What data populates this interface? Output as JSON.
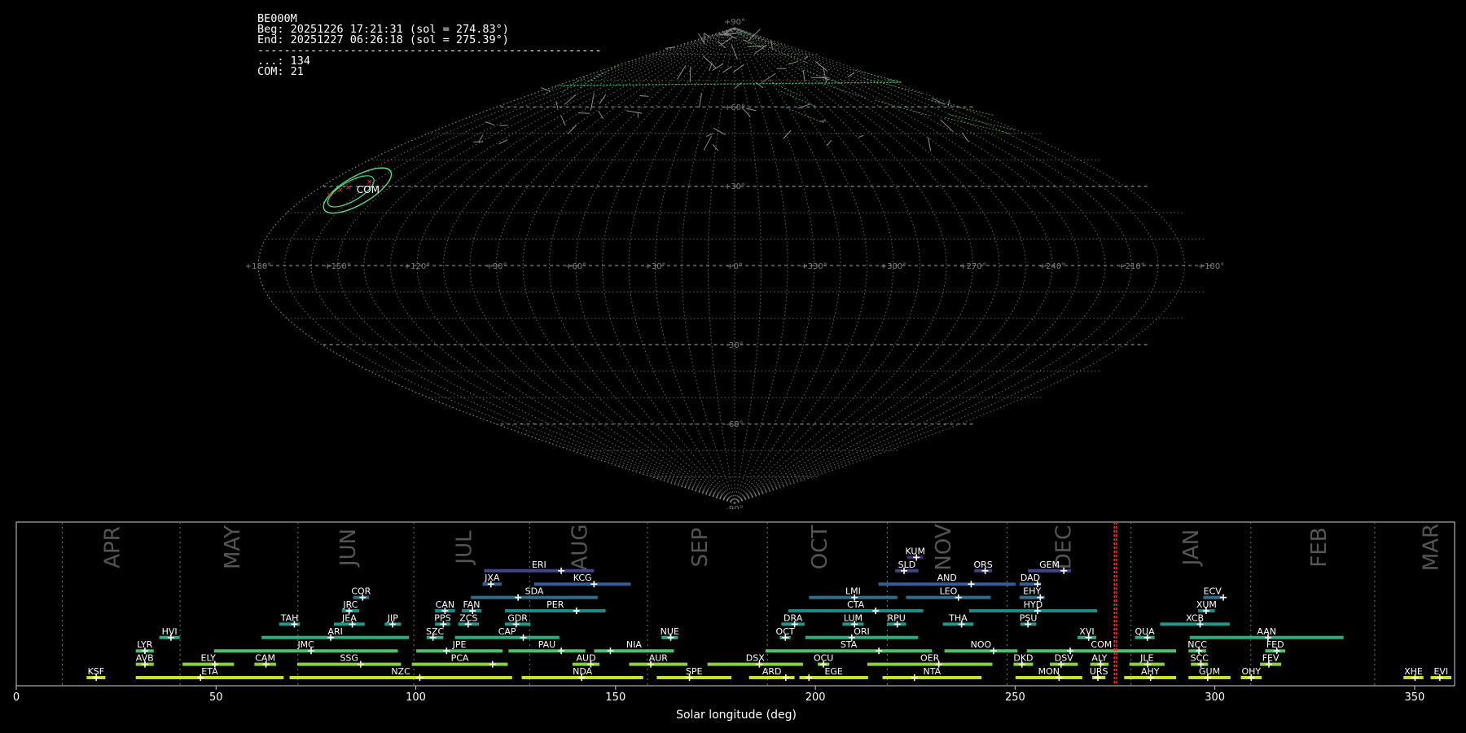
{
  "info": {
    "station": "BE000M",
    "begin": "Beg: 20251226 17:21:31 (sol = 274.83°)",
    "end": "End: 20251227 06:26:18 (sol = 275.39°)",
    "separator": "----------------------------------------------------",
    "sporadic_count": "...: 134",
    "com_count": "COM: 21"
  },
  "colors": {
    "background": "#000000",
    "grid": "#8a8a8a",
    "month_label": "#555555",
    "month_line": "#777777",
    "marker": "#ff2a2a",
    "meteor_trail": "#8d8d8d",
    "shower_trail": "#4fd37a",
    "radiant_highlight": "#56dd86"
  },
  "chart_data": [
    {
      "type": "scatter",
      "projection": "sinusoidal",
      "title": "",
      "lat_labels": [
        "+90°",
        "+60°",
        "+30°",
        "-30°",
        "-60°",
        "-90°"
      ],
      "lat_values": [
        90,
        60,
        30,
        -30,
        -60,
        -90
      ],
      "lon_labels": [
        "+180°",
        "+150°",
        "+120°",
        "+90°",
        "+60°",
        "+30°",
        "+0°",
        "+330°",
        "+300°",
        "+270°",
        "+240°",
        "+210°",
        "+180°"
      ],
      "highlight_shower": {
        "code": "COM",
        "ra_deg": 164,
        "dec_deg": 29
      },
      "grid": true
    },
    {
      "type": "bar",
      "xlabel": "Solar longitude (deg)",
      "ylabel": "",
      "xlim": [
        0,
        360
      ],
      "xticks": [
        0,
        50,
        100,
        150,
        200,
        250,
        300,
        350
      ],
      "current_sol": [
        274.83,
        275.39
      ],
      "months": [
        {
          "name": "APR",
          "start": 11.5,
          "center": 24
        },
        {
          "name": "MAY",
          "start": 41,
          "center": 54
        },
        {
          "name": "JUN",
          "start": 70.5,
          "center": 83
        },
        {
          "name": "JUL",
          "start": 99.5,
          "center": 112
        },
        {
          "name": "AUG",
          "start": 128.5,
          "center": 141
        },
        {
          "name": "SEP",
          "start": 158,
          "center": 171
        },
        {
          "name": "OCT",
          "start": 188,
          "center": 201
        },
        {
          "name": "NOV",
          "start": 218,
          "center": 232
        },
        {
          "name": "DEC",
          "start": 248,
          "center": 262
        },
        {
          "name": "JAN",
          "start": 279,
          "center": 294
        },
        {
          "name": "FEB",
          "start": 309,
          "center": 326
        },
        {
          "name": "MAR",
          "start": 340,
          "center": 354
        }
      ],
      "showers": [
        {
          "code": "KSF",
          "start": 17.6,
          "end": 22.3,
          "peak": 20.0,
          "row": 0
        },
        {
          "code": "ETA",
          "start": 29.9,
          "end": 66.9,
          "peak": 46.1,
          "row": 0
        },
        {
          "code": "NZC",
          "start": 68.4,
          "end": 124.1,
          "peak": 101.0,
          "row": 0
        },
        {
          "code": "NDA",
          "start": 126.5,
          "end": 156.9,
          "peak": 141.5,
          "row": 0
        },
        {
          "code": "SPE",
          "start": 160.3,
          "end": 179.0,
          "peak": 168.5,
          "row": 0
        },
        {
          "code": "ARD",
          "start": 183.4,
          "end": 194.8,
          "peak": 192.6,
          "row": 0
        },
        {
          "code": "EGE",
          "start": 196.0,
          "end": 213.2,
          "peak": 198.4,
          "row": 0
        },
        {
          "code": "NTA",
          "start": 216.8,
          "end": 241.6,
          "peak": 224.8,
          "row": 0
        },
        {
          "code": "MON",
          "start": 250.1,
          "end": 266.8,
          "peak": 261.0,
          "row": 0
        },
        {
          "code": "URS",
          "start": 269.3,
          "end": 272.6,
          "peak": 270.7,
          "row": 0
        },
        {
          "code": "AHY",
          "start": 277.3,
          "end": 290.3,
          "peak": 283.9,
          "row": 0
        },
        {
          "code": "GUM",
          "start": 293.4,
          "end": 303.9,
          "peak": 298.2,
          "row": 0
        },
        {
          "code": "OHY",
          "start": 306.5,
          "end": 311.7,
          "peak": 309.1,
          "row": 0
        },
        {
          "code": "XHE",
          "start": 347.2,
          "end": 352.2,
          "peak": 350.1,
          "row": 0
        },
        {
          "code": "EVI",
          "start": 354.0,
          "end": 359.2,
          "peak": 356.3,
          "row": 0
        },
        {
          "code": "AVB",
          "start": 29.9,
          "end": 34.4,
          "peak": 32.2,
          "row": 1
        },
        {
          "code": "ELY",
          "start": 41.6,
          "end": 54.5,
          "peak": 49.7,
          "row": 1
        },
        {
          "code": "CAM",
          "start": 59.6,
          "end": 65.0,
          "peak": 62.5,
          "row": 1
        },
        {
          "code": "SSG",
          "start": 70.3,
          "end": 96.3,
          "peak": 86.2,
          "row": 1
        },
        {
          "code": "PCA",
          "start": 99.0,
          "end": 123.0,
          "peak": 119.2,
          "row": 1
        },
        {
          "code": "AUD",
          "start": 139.2,
          "end": 146.0,
          "peak": 143.8,
          "row": 1
        },
        {
          "code": "AUR",
          "start": 153.4,
          "end": 168.0,
          "peak": 158.8,
          "row": 1
        },
        {
          "code": "DSX",
          "start": 173.0,
          "end": 196.9,
          "peak": 186.0,
          "row": 1
        },
        {
          "code": "OCU",
          "start": 200.6,
          "end": 203.5,
          "peak": 202.0,
          "row": 1
        },
        {
          "code": "OER",
          "start": 213.0,
          "end": 244.3,
          "peak": 230.9,
          "row": 1
        },
        {
          "code": "DKD",
          "start": 249.6,
          "end": 254.5,
          "peak": 251.7,
          "row": 1
        },
        {
          "code": "DSV",
          "start": 258.7,
          "end": 265.7,
          "peak": 261.5,
          "row": 1
        },
        {
          "code": "ALY",
          "start": 268.8,
          "end": 273.4,
          "peak": 271.4,
          "row": 1
        },
        {
          "code": "JLE",
          "start": 278.6,
          "end": 287.4,
          "peak": 283.2,
          "row": 1
        },
        {
          "code": "SCC",
          "start": 294.0,
          "end": 298.3,
          "peak": 296.5,
          "row": 1
        },
        {
          "code": "FEV",
          "start": 311.3,
          "end": 316.6,
          "peak": 313.5,
          "row": 1
        },
        {
          "code": "LYR",
          "start": 29.9,
          "end": 34.4,
          "peak": 32.2,
          "row": 2
        },
        {
          "code": "JMC",
          "start": 49.5,
          "end": 95.5,
          "peak": 73.8,
          "row": 2
        },
        {
          "code": "JPE",
          "start": 100.1,
          "end": 121.7,
          "peak": 107.7,
          "row": 2
        },
        {
          "code": "PAU",
          "start": 123.2,
          "end": 142.4,
          "peak": 136.4,
          "row": 2
        },
        {
          "code": "NIA",
          "start": 144.6,
          "end": 164.6,
          "peak": 148.7,
          "row": 2
        },
        {
          "code": "STA",
          "start": 187.5,
          "end": 229.2,
          "peak": 215.9,
          "row": 2
        },
        {
          "code": "NOO",
          "start": 232.3,
          "end": 250.6,
          "peak": 244.6,
          "row": 2
        },
        {
          "code": "COM",
          "start": 252.9,
          "end": 290.3,
          "peak": 263.8,
          "row": 2
        },
        {
          "code": "NCC",
          "start": 293.4,
          "end": 297.8,
          "peak": 296.0,
          "row": 2
        },
        {
          "code": "FED",
          "start": 312.6,
          "end": 317.6,
          "peak": 315.5,
          "row": 2
        },
        {
          "code": "HVI",
          "start": 35.8,
          "end": 40.9,
          "peak": 38.7,
          "row": 3
        },
        {
          "code": "ARI",
          "start": 61.4,
          "end": 98.3,
          "peak": 78.7,
          "row": 3
        },
        {
          "code": "SZC",
          "start": 102.7,
          "end": 106.9,
          "peak": 104.3,
          "row": 3
        },
        {
          "code": "CAP",
          "start": 109.8,
          "end": 135.9,
          "peak": 126.9,
          "row": 3
        },
        {
          "code": "NUE",
          "start": 161.5,
          "end": 165.6,
          "peak": 163.8,
          "row": 3
        },
        {
          "code": "OCT",
          "start": 191.1,
          "end": 193.8,
          "peak": 192.5,
          "row": 3
        },
        {
          "code": "ORI",
          "start": 197.5,
          "end": 225.7,
          "peak": 209.1,
          "row": 3
        },
        {
          "code": "XVI",
          "start": 265.6,
          "end": 270.3,
          "peak": 268.4,
          "row": 3
        },
        {
          "code": "QUA",
          "start": 280.0,
          "end": 284.9,
          "peak": 283.1,
          "row": 3
        },
        {
          "code": "AAN",
          "start": 293.7,
          "end": 332.2,
          "peak": 313.3,
          "row": 3
        },
        {
          "code": "TAH",
          "start": 65.8,
          "end": 71.0,
          "peak": 69.6,
          "row": 4
        },
        {
          "code": "JEA",
          "start": 79.5,
          "end": 87.2,
          "peak": 84.1,
          "row": 4
        },
        {
          "code": "JIP",
          "start": 92.2,
          "end": 96.3,
          "peak": 94.2,
          "row": 4
        },
        {
          "code": "PPS",
          "start": 104.8,
          "end": 108.6,
          "peak": 106.9,
          "row": 4
        },
        {
          "code": "ZCS",
          "start": 110.6,
          "end": 115.8,
          "peak": 113.1,
          "row": 4
        },
        {
          "code": "GDR",
          "start": 122.3,
          "end": 128.7,
          "peak": 125.1,
          "row": 4
        },
        {
          "code": "DRA",
          "start": 191.5,
          "end": 197.3,
          "peak": 194.8,
          "row": 4
        },
        {
          "code": "LUM",
          "start": 206.8,
          "end": 212.1,
          "peak": 209.8,
          "row": 4
        },
        {
          "code": "RPU",
          "start": 217.9,
          "end": 222.7,
          "peak": 220.5,
          "row": 4
        },
        {
          "code": "THA",
          "start": 231.9,
          "end": 239.6,
          "peak": 236.6,
          "row": 4
        },
        {
          "code": "PSU",
          "start": 251.3,
          "end": 255.3,
          "peak": 253.2,
          "row": 4
        },
        {
          "code": "XCB",
          "start": 286.3,
          "end": 303.7,
          "peak": 296.3,
          "row": 4
        },
        {
          "code": "JRC",
          "start": 81.5,
          "end": 85.8,
          "peak": 83.3,
          "row": 5
        },
        {
          "code": "CAN",
          "start": 104.8,
          "end": 109.8,
          "peak": 107.3,
          "row": 5
        },
        {
          "code": "FAN",
          "start": 111.5,
          "end": 116.4,
          "peak": 114.2,
          "row": 5
        },
        {
          "code": "PER",
          "start": 122.3,
          "end": 147.5,
          "peak": 140.2,
          "row": 5
        },
        {
          "code": "CTA",
          "start": 193.2,
          "end": 227.0,
          "peak": 215.1,
          "row": 5
        },
        {
          "code": "HYD",
          "start": 238.5,
          "end": 270.5,
          "peak": 255.6,
          "row": 5
        },
        {
          "code": "XUM",
          "start": 295.8,
          "end": 300.0,
          "peak": 297.8,
          "row": 5
        },
        {
          "code": "COR",
          "start": 84.3,
          "end": 88.3,
          "peak": 86.7,
          "row": 6
        },
        {
          "code": "SDA",
          "start": 113.8,
          "end": 145.5,
          "peak": 125.6,
          "row": 6
        },
        {
          "code": "LMI",
          "start": 198.4,
          "end": 220.5,
          "peak": 209.8,
          "row": 6
        },
        {
          "code": "LEO",
          "start": 222.7,
          "end": 243.9,
          "peak": 235.8,
          "row": 6
        },
        {
          "code": "EHY",
          "start": 251.1,
          "end": 257.4,
          "peak": 256.3,
          "row": 6
        },
        {
          "code": "ECV",
          "start": 297.1,
          "end": 301.7,
          "peak": 302.1,
          "row": 6
        },
        {
          "code": "JXA",
          "start": 116.7,
          "end": 121.5,
          "peak": 118.8,
          "row": 7
        },
        {
          "code": "KCG",
          "start": 129.6,
          "end": 153.8,
          "peak": 144.6,
          "row": 7
        },
        {
          "code": "AND",
          "start": 215.8,
          "end": 250.1,
          "peak": 239.0,
          "row": 7
        },
        {
          "code": "DAD",
          "start": 251.1,
          "end": 256.5,
          "peak": 255.6,
          "row": 7
        },
        {
          "code": "ERI",
          "start": 117.1,
          "end": 144.6,
          "peak": 136.4,
          "row": 8
        },
        {
          "code": "SLD",
          "start": 220.0,
          "end": 225.8,
          "peak": 222.2,
          "row": 8
        },
        {
          "code": "ORS",
          "start": 239.8,
          "end": 244.2,
          "peak": 242.5,
          "row": 8
        },
        {
          "code": "GEM",
          "start": 253.2,
          "end": 264.0,
          "peak": 262.2,
          "row": 8
        },
        {
          "code": "KUM",
          "start": 223.0,
          "end": 227.0,
          "peak": 225.3,
          "row": 9
        }
      ]
    }
  ]
}
